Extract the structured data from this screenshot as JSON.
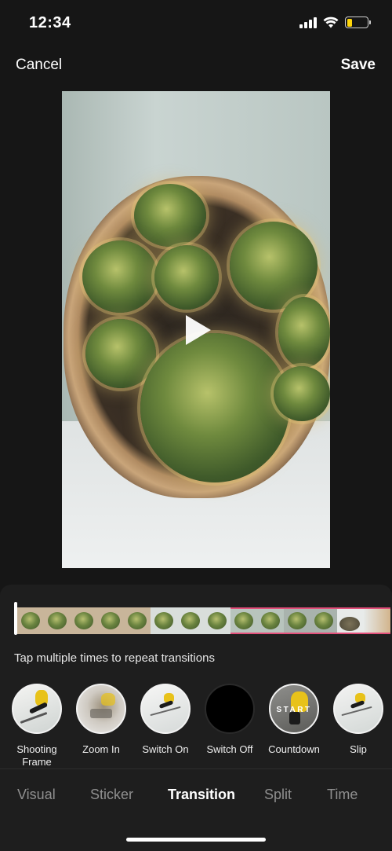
{
  "status_bar": {
    "time": "12:34",
    "battery_level": 0.25,
    "battery_color": "#ffd60a",
    "icons": [
      "signal-icon",
      "wifi-icon",
      "battery-icon"
    ]
  },
  "top_bar": {
    "cancel_label": "Cancel",
    "save_label": "Save"
  },
  "video": {
    "play_icon": "play-icon"
  },
  "timeline": {
    "hint": "Tap multiple times to repeat transitions"
  },
  "effects": [
    {
      "label": "Shooting\nFrame",
      "icon": "shooting-frame-thumbnail"
    },
    {
      "label": "Zoom In",
      "icon": "zoom-in-thumbnail"
    },
    {
      "label": "Switch On",
      "icon": "switch-on-thumbnail"
    },
    {
      "label": "Switch Off",
      "icon": "switch-off-thumbnail"
    },
    {
      "label": "Countdown",
      "icon": "countdown-thumbnail",
      "overlay_text": "START"
    },
    {
      "label": "Slip",
      "icon": "slip-thumbnail"
    }
  ],
  "tabs": [
    {
      "label": "Visual",
      "active": false
    },
    {
      "label": "Sticker",
      "active": false
    },
    {
      "label": "Transition",
      "active": true
    },
    {
      "label": "Split",
      "active": false
    },
    {
      "label": "Time",
      "active": false
    }
  ]
}
